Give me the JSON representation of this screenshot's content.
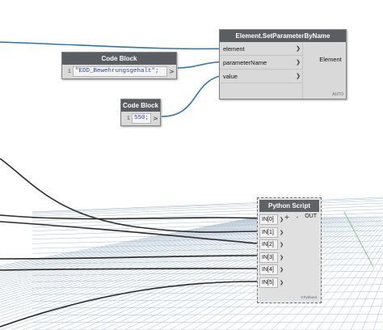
{
  "code_block_1": {
    "title": "Code Block",
    "line_number": "1",
    "code": "\"EDD_Bewehrungsgehalt\";",
    "output_glyph": ">"
  },
  "code_block_2": {
    "title": "Code Block",
    "line_number": "1",
    "code": "550;",
    "output_glyph": ">"
  },
  "set_parameter_node": {
    "title": "Element.SetParameterByName",
    "inputs": [
      "element",
      "parameterName",
      "value"
    ],
    "output": "Element",
    "lacing": "AUTO"
  },
  "python_node": {
    "title": "Python Script",
    "inputs": [
      "IN[0]",
      "IN[1]",
      "IN[2]",
      "IN[3]",
      "IN[4]",
      "IN[5]"
    ],
    "add_label": "+",
    "remove_label": "-",
    "output": "OUT",
    "footer": "CPython3"
  },
  "colors": {
    "active_wire": "#2e74b5",
    "inactive_wire": "#2b2b2b",
    "node_header": "#5a5d62",
    "node_body": "#d9d9d9",
    "grid_line": "#a8bccd"
  }
}
